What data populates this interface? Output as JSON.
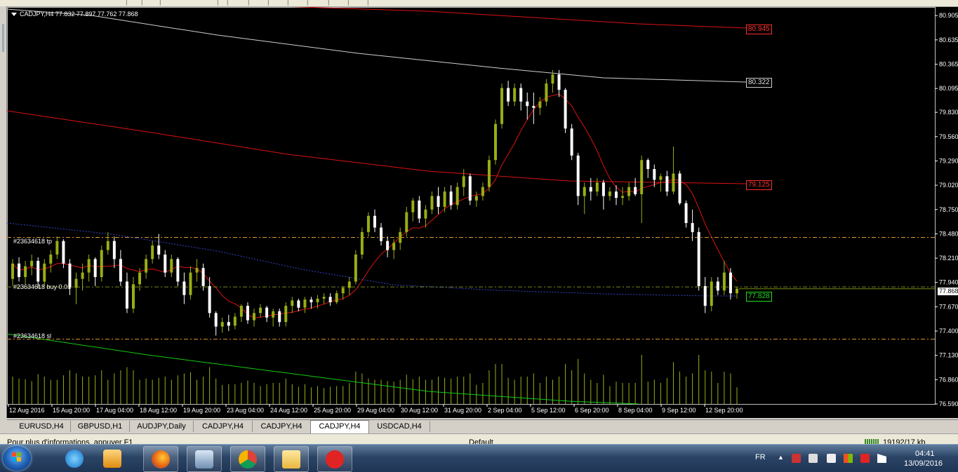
{
  "window": {
    "symbol_info": "CADJPY,H4  77.832 77.897 77.762 77.868",
    "order_labels": {
      "tp": "#23634618 tp",
      "buy": "#23634618 buy 0.01",
      "sl": "#23634618 sl"
    }
  },
  "price_axis": {
    "ticks": [
      "80.905",
      "80.635",
      "80.365",
      "80.095",
      "79.830",
      "79.560",
      "79.290",
      "79.020",
      "78.750",
      "78.480",
      "78.210",
      "77.940",
      "77.670",
      "77.400",
      "77.130",
      "76.860",
      "76.590"
    ],
    "current_price": "77.868"
  },
  "price_boxes": {
    "ma_top": "80.945",
    "ma_grey": "80.322",
    "ma_mid": "79.125",
    "bid": "77.828"
  },
  "time_axis": [
    "12 Aug 2016",
    "15 Aug 20:00",
    "17 Aug 04:00",
    "18 Aug 12:00",
    "19 Aug 20:00",
    "23 Aug 04:00",
    "24 Aug 12:00",
    "25 Aug 20:00",
    "29 Aug 04:00",
    "30 Aug 12:00",
    "31 Aug 20:00",
    "2 Sep 04:00",
    "5 Sep 12:00",
    "6 Sep 20:00",
    "8 Sep 04:00",
    "9 Sep 12:00",
    "12 Sep 20:00"
  ],
  "tabs": [
    "EURUSD,H4",
    "GBPUSD,H1",
    "AUDJPY,Daily",
    "CADJPY,H4",
    "CADJPY,H4",
    "CADJPY,H4",
    "USDCAD,H4"
  ],
  "active_tab": 5,
  "status": {
    "help": "Pour plus d'informations, appuyer F1",
    "profile": "Default",
    "connection": "19192/17 kb"
  },
  "taskbar": {
    "apps": [
      "ie-icon",
      "media-player-icon",
      "firefox-icon",
      "remote-icon",
      "chrome-icon",
      "explorer-icon",
      "pushbullet-icon"
    ],
    "language": "FR",
    "time": "04:41",
    "date": "13/09/2016"
  },
  "colors": {
    "bull": "#9aad14",
    "bear": "#ffffff",
    "ma_red": "#dd1111",
    "ma_grey": "#cfcfcf",
    "ma_green": "#11cc11",
    "ma_blue": "#3344cc",
    "order_line": "#e09a2a",
    "volume": "#9aad14"
  },
  "chart_data": {
    "type": "candlestick",
    "symbol": "CADJPY",
    "timeframe": "H4",
    "ylim": [
      76.59,
      81.0
    ],
    "candles": [
      [
        77.98,
        78.2,
        77.9,
        78.15
      ],
      [
        78.15,
        78.22,
        77.95,
        78.0
      ],
      [
        78.0,
        78.18,
        77.92,
        78.12
      ],
      [
        78.12,
        78.25,
        78.02,
        78.18
      ],
      [
        78.18,
        78.22,
        77.88,
        77.95
      ],
      [
        77.95,
        78.2,
        77.9,
        78.15
      ],
      [
        78.15,
        78.3,
        78.05,
        78.25
      ],
      [
        78.25,
        78.45,
        78.2,
        78.4
      ],
      [
        78.4,
        78.42,
        78.1,
        78.15
      ],
      [
        78.15,
        78.2,
        77.8,
        77.88
      ],
      [
        77.88,
        78.05,
        77.7,
        77.98
      ],
      [
        77.98,
        78.15,
        77.85,
        78.05
      ],
      [
        78.05,
        78.25,
        77.95,
        78.2
      ],
      [
        78.2,
        78.22,
        77.9,
        78.0
      ],
      [
        78.0,
        78.35,
        77.95,
        78.3
      ],
      [
        78.3,
        78.5,
        78.25,
        78.4
      ],
      [
        78.4,
        78.45,
        78.1,
        78.2
      ],
      [
        78.2,
        78.3,
        77.9,
        77.95
      ],
      [
        77.95,
        78.05,
        77.6,
        77.65
      ],
      [
        77.65,
        78.0,
        77.6,
        77.92
      ],
      [
        77.92,
        78.1,
        77.85,
        78.05
      ],
      [
        78.05,
        78.25,
        77.98,
        78.2
      ],
      [
        78.2,
        78.4,
        78.15,
        78.35
      ],
      [
        78.35,
        78.48,
        78.2,
        78.25
      ],
      [
        78.25,
        78.3,
        78.0,
        78.05
      ],
      [
        78.05,
        78.25,
        78.0,
        78.2
      ],
      [
        78.2,
        78.22,
        77.9,
        77.95
      ],
      [
        77.95,
        78.05,
        77.7,
        77.8
      ],
      [
        77.8,
        78.12,
        77.75,
        78.05
      ],
      [
        78.05,
        78.2,
        77.95,
        78.1
      ],
      [
        78.1,
        78.15,
        77.85,
        77.9
      ],
      [
        77.9,
        78.0,
        77.55,
        77.6
      ],
      [
        77.6,
        77.62,
        77.35,
        77.45
      ],
      [
        77.45,
        77.55,
        77.38,
        77.5
      ],
      [
        77.5,
        77.58,
        77.4,
        77.46
      ],
      [
        77.46,
        77.6,
        77.42,
        77.56
      ],
      [
        77.56,
        77.7,
        77.5,
        77.68
      ],
      [
        77.68,
        77.72,
        77.48,
        77.52
      ],
      [
        77.52,
        77.65,
        77.45,
        77.6
      ],
      [
        77.6,
        77.7,
        77.55,
        77.66
      ],
      [
        77.66,
        77.68,
        77.5,
        77.55
      ],
      [
        77.55,
        77.65,
        77.45,
        77.62
      ],
      [
        77.62,
        77.65,
        77.45,
        77.5
      ],
      [
        77.5,
        77.72,
        77.45,
        77.68
      ],
      [
        77.68,
        77.78,
        77.6,
        77.74
      ],
      [
        77.74,
        77.76,
        77.62,
        77.66
      ],
      [
        77.66,
        77.78,
        77.6,
        77.75
      ],
      [
        77.75,
        77.78,
        77.65,
        77.72
      ],
      [
        77.72,
        77.8,
        77.65,
        77.76
      ],
      [
        77.76,
        77.82,
        77.7,
        77.78
      ],
      [
        77.78,
        77.82,
        77.68,
        77.72
      ],
      [
        77.72,
        77.85,
        77.7,
        77.82
      ],
      [
        77.82,
        77.9,
        77.75,
        77.88
      ],
      [
        77.88,
        78.0,
        77.8,
        77.95
      ],
      [
        77.95,
        78.3,
        77.92,
        78.25
      ],
      [
        78.25,
        78.55,
        78.2,
        78.5
      ],
      [
        78.5,
        78.72,
        78.45,
        78.68
      ],
      [
        78.68,
        78.75,
        78.5,
        78.55
      ],
      [
        78.55,
        78.6,
        78.35,
        78.4
      ],
      [
        78.4,
        78.45,
        78.22,
        78.3
      ],
      [
        78.3,
        78.42,
        78.2,
        78.38
      ],
      [
        78.38,
        78.55,
        78.3,
        78.5
      ],
      [
        78.5,
        78.78,
        78.45,
        78.72
      ],
      [
        78.72,
        78.88,
        78.62,
        78.85
      ],
      [
        78.85,
        78.9,
        78.6,
        78.65
      ],
      [
        78.65,
        78.8,
        78.55,
        78.75
      ],
      [
        78.75,
        78.95,
        78.7,
        78.9
      ],
      [
        78.9,
        79.0,
        78.7,
        78.78
      ],
      [
        78.78,
        79.0,
        78.72,
        78.95
      ],
      [
        78.95,
        79.02,
        78.75,
        78.8
      ],
      [
        78.8,
        79.05,
        78.75,
        79.0
      ],
      [
        79.0,
        79.2,
        78.9,
        79.12
      ],
      [
        79.12,
        79.15,
        78.8,
        78.85
      ],
      [
        78.85,
        78.95,
        78.78,
        78.9
      ],
      [
        78.9,
        79.05,
        78.85,
        79.0
      ],
      [
        79.0,
        79.35,
        78.95,
        79.3
      ],
      [
        79.3,
        79.75,
        79.25,
        79.7
      ],
      [
        79.7,
        80.15,
        79.65,
        80.1
      ],
      [
        80.1,
        80.18,
        79.9,
        79.95
      ],
      [
        79.95,
        80.15,
        79.9,
        80.1
      ],
      [
        80.1,
        80.15,
        79.85,
        79.95
      ],
      [
        79.95,
        80.05,
        79.75,
        79.9
      ],
      [
        79.9,
        80.05,
        79.7,
        79.88
      ],
      [
        79.88,
        80.0,
        79.8,
        79.95
      ],
      [
        79.95,
        80.2,
        79.9,
        80.15
      ],
      [
        80.15,
        80.3,
        80.05,
        80.25
      ],
      [
        80.25,
        80.3,
        80.0,
        80.08
      ],
      [
        80.08,
        80.1,
        79.6,
        79.65
      ],
      [
        79.65,
        79.7,
        79.3,
        79.35
      ],
      [
        79.35,
        79.38,
        78.8,
        78.9
      ],
      [
        78.9,
        79.05,
        78.7,
        79.0
      ],
      [
        79.0,
        79.1,
        78.85,
        78.95
      ],
      [
        78.95,
        79.1,
        78.9,
        79.05
      ],
      [
        79.05,
        79.08,
        78.75,
        78.9
      ],
      [
        78.9,
        79.0,
        78.85,
        78.95
      ],
      [
        78.95,
        79.02,
        78.8,
        78.88
      ],
      [
        78.88,
        79.0,
        78.8,
        78.9
      ],
      [
        78.9,
        79.05,
        78.85,
        79.0
      ],
      [
        79.0,
        79.1,
        78.9,
        78.92
      ],
      [
        78.92,
        79.35,
        78.6,
        79.3
      ],
      [
        79.3,
        79.32,
        79.1,
        79.2
      ],
      [
        79.2,
        79.25,
        79.0,
        79.08
      ],
      [
        79.08,
        79.15,
        78.95,
        79.12
      ],
      [
        79.12,
        79.18,
        78.9,
        78.95
      ],
      [
        78.95,
        79.45,
        78.92,
        79.15
      ],
      [
        79.15,
        79.18,
        78.8,
        78.82
      ],
      [
        78.82,
        78.85,
        78.55,
        78.6
      ],
      [
        78.6,
        78.75,
        78.4,
        78.5
      ],
      [
        78.5,
        78.55,
        77.85,
        77.9
      ],
      [
        77.9,
        78.0,
        77.6,
        77.68
      ],
      [
        77.68,
        78.0,
        77.62,
        77.95
      ],
      [
        77.95,
        78.0,
        77.8,
        77.85
      ],
      [
        77.85,
        78.18,
        77.8,
        78.05
      ],
      [
        78.05,
        78.1,
        77.75,
        77.82
      ],
      [
        77.82,
        77.89,
        77.76,
        77.87
      ]
    ],
    "volume_hint": "tick volume bars along bottom",
    "moving_averages": [
      "red short MA",
      "red long MA",
      "grey MA",
      "green MA",
      "blue dotted MA"
    ],
    "order_lines": {
      "tp": 78.44,
      "buy": 77.89,
      "sl": 77.31
    }
  }
}
